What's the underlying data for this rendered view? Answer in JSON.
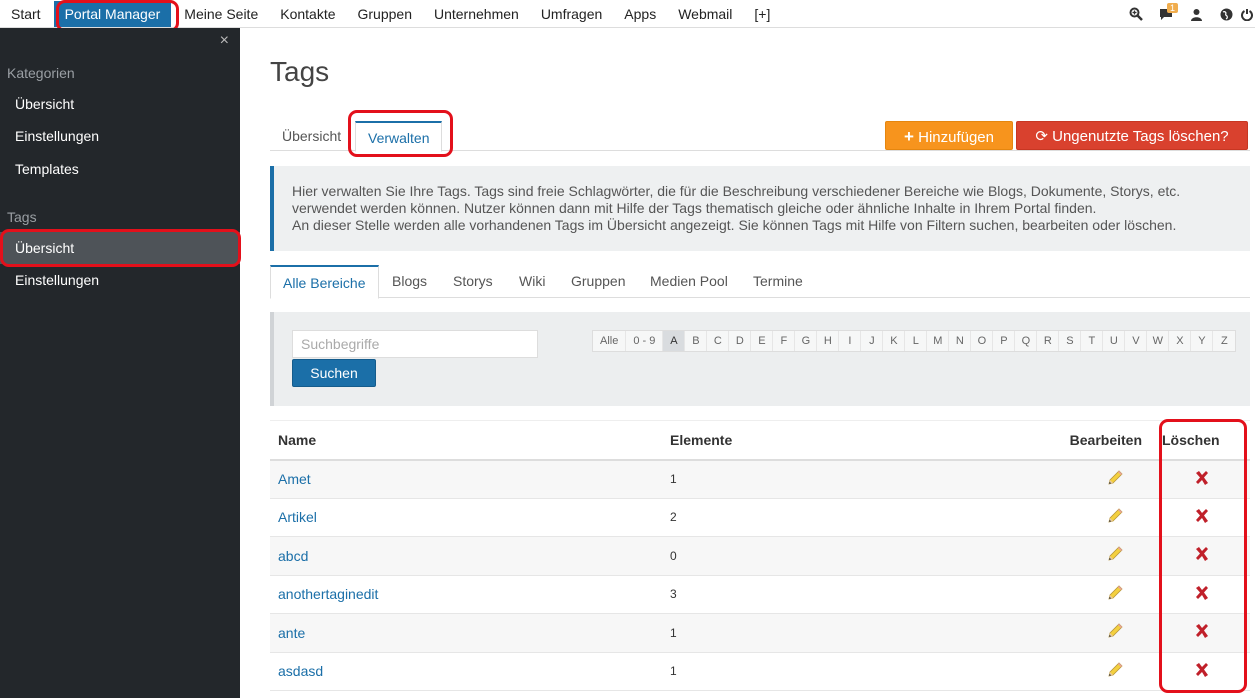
{
  "topnav": {
    "items": [
      "Start",
      "Portal Manager",
      "Meine Seite",
      "Kontakte",
      "Gruppen",
      "Unternehmen",
      "Umfragen",
      "Apps",
      "Webmail",
      "[+]"
    ],
    "notification_count": "1",
    "icons": [
      "search-icon",
      "chat-icon",
      "user-icon",
      "globe-icon",
      "power-icon"
    ]
  },
  "sidebar": {
    "close": "×",
    "section1": "Kategorien",
    "cat_items": [
      "Übersicht",
      "Einstellungen",
      "Templates"
    ],
    "section2": "Tags",
    "tag_items": [
      "Übersicht",
      "Einstellungen"
    ]
  },
  "main": {
    "title": "Tags",
    "tabs": [
      "Übersicht",
      "Verwalten"
    ],
    "add_button": "Hinzufügen",
    "delete_unused_button": "Ungenutzte Tags löschen?",
    "info": {
      "line1": "Hier verwalten Sie Ihre Tags. Tags sind freie Schlagwörter, die für die Beschreibung verschiedener Bereiche wie Blogs, Dokumente, Storys, etc.",
      "line2": "verwendet werden können. Nutzer können dann mit Hilfe der Tags thematisch gleiche oder ähnliche Inhalte in Ihrem Portal finden.",
      "line3": "An dieser Stelle werden alle vorhandenen Tags im Übersicht angezeigt. Sie können Tags mit Hilfe von Filtern suchen, bearbeiten oder löschen."
    },
    "area_tabs": [
      "Alle Bereiche",
      "Blogs",
      "Storys",
      "Wiki",
      "Gruppen",
      "Medien Pool",
      "Termine"
    ],
    "search": {
      "placeholder": "Suchbegriffe",
      "button": "Suchen"
    },
    "alphabet": [
      "Alle",
      "0 - 9",
      "A",
      "B",
      "C",
      "D",
      "E",
      "F",
      "G",
      "H",
      "I",
      "J",
      "K",
      "L",
      "M",
      "N",
      "O",
      "P",
      "Q",
      "R",
      "S",
      "T",
      "U",
      "V",
      "W",
      "X",
      "Y",
      "Z"
    ],
    "alphabet_selected": "A",
    "table": {
      "headers": {
        "name": "Name",
        "elements": "Elemente",
        "edit": "Bearbeiten",
        "delete": "Löschen"
      },
      "rows": [
        {
          "name": "Amet",
          "elements": "1"
        },
        {
          "name": "Artikel",
          "elements": "2"
        },
        {
          "name": "abcd",
          "elements": "0"
        },
        {
          "name": "anothertaginedit",
          "elements": "3"
        },
        {
          "name": "ante",
          "elements": "1"
        },
        {
          "name": "asdasd",
          "elements": "1"
        }
      ]
    }
  },
  "colors": {
    "primary": "#1b6fa8",
    "orange": "#f7941d",
    "red": "#d9412e",
    "sidebar": "#23272b",
    "highlight": "#e3101b"
  }
}
